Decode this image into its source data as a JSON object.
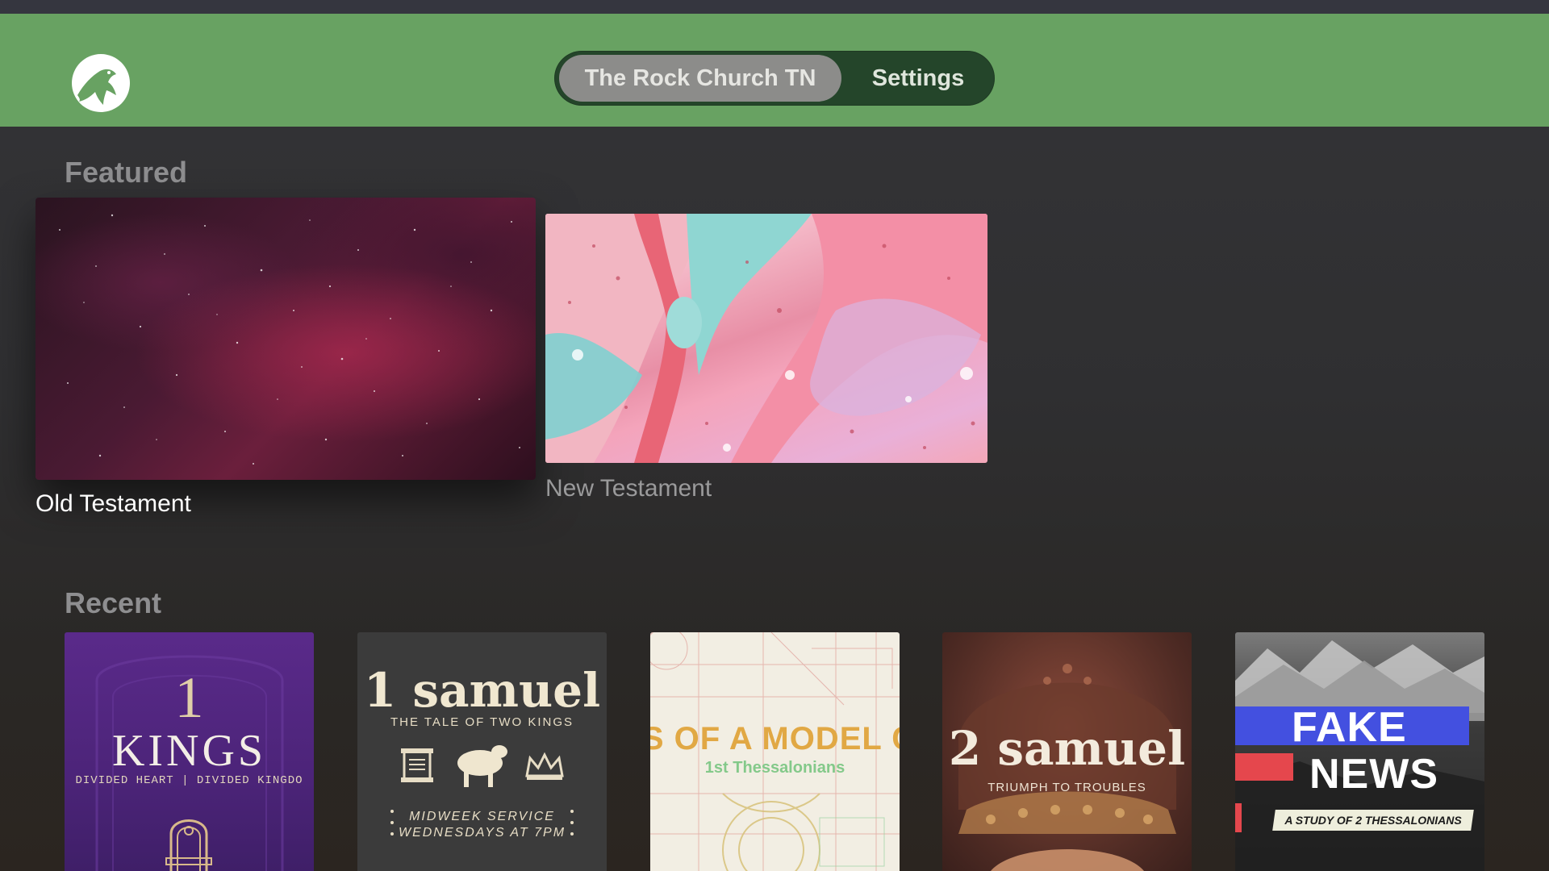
{
  "header": {
    "bg_color": "#68a262",
    "logo_icon": "rock-church-logo-icon",
    "tabs": [
      {
        "label": "The Rock Church TN",
        "active": true
      },
      {
        "label": "Settings",
        "active": false
      }
    ]
  },
  "featured": {
    "title": "Featured",
    "items": [
      {
        "label": "Old Testament",
        "focused": true
      },
      {
        "label": "New Testament",
        "focused": false
      }
    ]
  },
  "recent": {
    "title": "Recent",
    "items": [
      {
        "number": "1",
        "title": "KINGS",
        "subtitle": "DIVIDED HEART  |  DIVIDED KINGDO"
      },
      {
        "title": "1 samuel",
        "subtitle": "THE TALE OF TWO KINGS",
        "note_line1": "MIDWEEK SERVICE",
        "note_line2": "WEDNESDAYS AT 7PM"
      },
      {
        "title": "KS OF A MODEL CHU",
        "subtitle": "1st Thessalonians"
      },
      {
        "title": "2 samuel",
        "subtitle": "TRIUMPH TO TROUBLES"
      },
      {
        "title_line1": "FAKE",
        "title_line2": "NEWS",
        "subtitle": "A STUDY OF 2 THESSALONIANS"
      }
    ]
  }
}
